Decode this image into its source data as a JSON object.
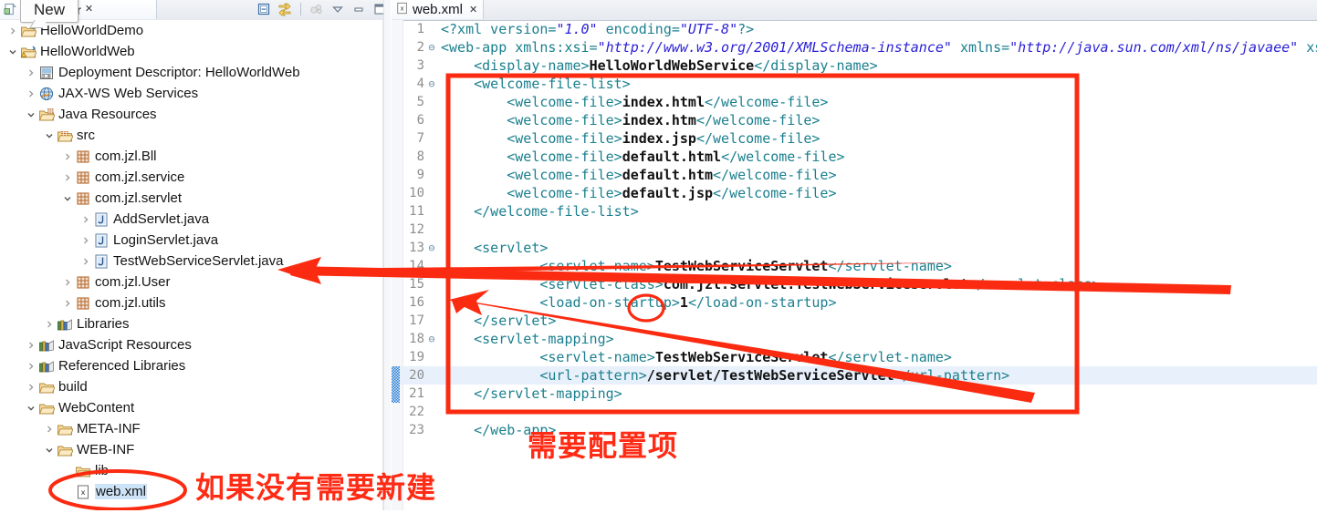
{
  "window": {
    "tooltip": "New"
  },
  "explorer": {
    "tab_label": "ct Explorer",
    "tab_close": "✕",
    "toolbar": [
      {
        "name": "collapse-all-icon",
        "title": "Collapse All"
      },
      {
        "name": "link-with-editor-icon",
        "title": "Link with Editor"
      },
      {
        "name": "view-menu-icon",
        "title": "View Menu"
      },
      {
        "name": "chevron-down-icon",
        "title": "Menu"
      },
      {
        "name": "minimize-icon",
        "title": "Minimize"
      },
      {
        "name": "maximize-icon",
        "title": "Maximize"
      }
    ],
    "tree": [
      {
        "label": "HelloWorldDemo",
        "indent": 0,
        "arrow": "collapsed",
        "icon": "project-folder-icon",
        "selected": false
      },
      {
        "label": "HelloWorldWeb",
        "indent": 0,
        "arrow": "expanded",
        "icon": "project-warning-icon",
        "selected": false
      },
      {
        "label": "Deployment Descriptor: HelloWorldWeb",
        "indent": 1,
        "arrow": "collapsed",
        "icon": "deployment-descriptor-icon",
        "selected": false
      },
      {
        "label": "JAX-WS Web Services",
        "indent": 1,
        "arrow": "collapsed",
        "icon": "web-service-icon",
        "selected": false
      },
      {
        "label": "Java Resources",
        "indent": 1,
        "arrow": "expanded",
        "icon": "java-resources-icon",
        "selected": false
      },
      {
        "label": "src",
        "indent": 2,
        "arrow": "expanded",
        "icon": "source-folder-icon",
        "selected": false
      },
      {
        "label": "com.jzl.Bll",
        "indent": 3,
        "arrow": "collapsed",
        "icon": "package-icon",
        "selected": false
      },
      {
        "label": "com.jzl.service",
        "indent": 3,
        "arrow": "collapsed",
        "icon": "package-icon",
        "selected": false
      },
      {
        "label": "com.jzl.servlet",
        "indent": 3,
        "arrow": "expanded",
        "icon": "package-icon",
        "selected": false
      },
      {
        "label": "AddServlet.java",
        "indent": 4,
        "arrow": "collapsed",
        "icon": "java-file-icon",
        "selected": false
      },
      {
        "label": "LoginServlet.java",
        "indent": 4,
        "arrow": "collapsed",
        "icon": "java-file-icon",
        "selected": false
      },
      {
        "label": "TestWebServiceServlet.java",
        "indent": 4,
        "arrow": "collapsed",
        "icon": "java-file-icon",
        "selected": false
      },
      {
        "label": "com.jzl.User",
        "indent": 3,
        "arrow": "collapsed",
        "icon": "package-icon",
        "selected": false
      },
      {
        "label": "com.jzl.utils",
        "indent": 3,
        "arrow": "collapsed",
        "icon": "package-icon",
        "selected": false
      },
      {
        "label": "Libraries",
        "indent": 2,
        "arrow": "collapsed",
        "icon": "libraries-icon",
        "selected": false
      },
      {
        "label": "JavaScript Resources",
        "indent": 1,
        "arrow": "collapsed",
        "icon": "libraries-icon",
        "selected": false
      },
      {
        "label": "Referenced Libraries",
        "indent": 1,
        "arrow": "collapsed",
        "icon": "libraries-icon",
        "selected": false
      },
      {
        "label": "build",
        "indent": 1,
        "arrow": "collapsed",
        "icon": "folder-icon",
        "selected": false
      },
      {
        "label": "WebContent",
        "indent": 1,
        "arrow": "expanded",
        "icon": "folder-icon",
        "selected": false
      },
      {
        "label": "META-INF",
        "indent": 2,
        "arrow": "collapsed",
        "icon": "folder-icon",
        "selected": false
      },
      {
        "label": "WEB-INF",
        "indent": 2,
        "arrow": "expanded",
        "icon": "folder-icon",
        "selected": false
      },
      {
        "label": "lib",
        "indent": 3,
        "arrow": "none",
        "icon": "folder-icon",
        "selected": false
      },
      {
        "label": "web.xml",
        "indent": 3,
        "arrow": "none",
        "icon": "xml-file-icon",
        "selected": true
      }
    ]
  },
  "editor": {
    "tab_label": "web.xml",
    "tab_close": "✕",
    "tab_icon": "xml-file-icon",
    "highlight_line": 20,
    "lines": [
      {
        "n": 1,
        "fold": "",
        "indent": 0,
        "text": "<?xml version=\"1.0\" encoding=\"UTF-8\"?>"
      },
      {
        "n": 2,
        "fold": "⊖",
        "indent": 0,
        "text": "<web-app xmlns:xsi=\"http://www.w3.org/2001/XMLSchema-instance\" xmlns=\"http://java.sun.com/xml/ns/javaee\" xs"
      },
      {
        "n": 3,
        "fold": "",
        "indent": 1,
        "text": "<display-name>HelloWorldWebService</display-name>"
      },
      {
        "n": 4,
        "fold": "⊖",
        "indent": 1,
        "text": "<welcome-file-list>"
      },
      {
        "n": 5,
        "fold": "",
        "indent": 2,
        "text": "<welcome-file>index.html</welcome-file>"
      },
      {
        "n": 6,
        "fold": "",
        "indent": 2,
        "text": "<welcome-file>index.htm</welcome-file>"
      },
      {
        "n": 7,
        "fold": "",
        "indent": 2,
        "text": "<welcome-file>index.jsp</welcome-file>"
      },
      {
        "n": 8,
        "fold": "",
        "indent": 2,
        "text": "<welcome-file>default.html</welcome-file>"
      },
      {
        "n": 9,
        "fold": "",
        "indent": 2,
        "text": "<welcome-file>default.htm</welcome-file>"
      },
      {
        "n": 10,
        "fold": "",
        "indent": 2,
        "text": "<welcome-file>default.jsp</welcome-file>"
      },
      {
        "n": 11,
        "fold": "",
        "indent": 1,
        "text": "</welcome-file-list>"
      },
      {
        "n": 12,
        "fold": "",
        "indent": 0,
        "text": ""
      },
      {
        "n": 13,
        "fold": "⊖",
        "indent": 1,
        "text": "<servlet>"
      },
      {
        "n": 14,
        "fold": "",
        "indent": 3,
        "text": "<servlet-name>TestWebServiceServlet</servlet-name>"
      },
      {
        "n": 15,
        "fold": "",
        "indent": 3,
        "text": "<servlet-class>com.jzl.servlet.TestWebServiceServlet</servlet-class>"
      },
      {
        "n": 16,
        "fold": "",
        "indent": 3,
        "text": "<load-on-startup>1</load-on-startup>"
      },
      {
        "n": 17,
        "fold": "",
        "indent": 1,
        "text": "</servlet>"
      },
      {
        "n": 18,
        "fold": "⊖",
        "indent": 1,
        "text": "<servlet-mapping>"
      },
      {
        "n": 19,
        "fold": "",
        "indent": 3,
        "text": "<servlet-name>TestWebServiceServlet</servlet-name>"
      },
      {
        "n": 20,
        "fold": "",
        "indent": 3,
        "text": "<url-pattern>/servlet/TestWebServiceServlet</url-pattern>"
      },
      {
        "n": 21,
        "fold": "",
        "indent": 1,
        "text": "</servlet-mapping>"
      },
      {
        "n": 22,
        "fold": "",
        "indent": 0,
        "text": ""
      },
      {
        "n": 23,
        "fold": "",
        "indent": 1,
        "text": "</web-app>"
      }
    ]
  },
  "annotations": {
    "color": "#ff2b14",
    "note_config": "需要配置项",
    "note_create": "如果没有需要新建",
    "circle_targets": [
      "load-on-startup-value-1",
      "web-xml-tree-node"
    ],
    "box_target": "welcome-file-list-to-servlet-mapping"
  }
}
